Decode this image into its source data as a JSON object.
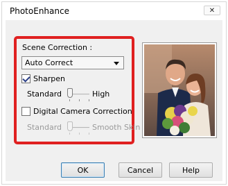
{
  "window": {
    "title": "PhotoEnhance",
    "close_glyph": "✕"
  },
  "scene": {
    "label": "Scene Correction :",
    "selected": "Auto Correct"
  },
  "sharpen": {
    "label": "Sharpen",
    "checked": true,
    "low_label": "Standard",
    "high_label": "High",
    "level": 0
  },
  "digital_camera": {
    "label": "Digital Camera Correction",
    "checked": false,
    "low_label": "Standard",
    "high_label": "Smooth Skin",
    "level": 0
  },
  "buttons": {
    "ok": "OK",
    "cancel": "Cancel",
    "help": "Help"
  },
  "colors": {
    "highlight": "#e02020",
    "checkmark": "#2a3e86",
    "client_bg": "#f0f0f0"
  },
  "icons": {
    "close": "close-icon",
    "dropdown": "chevron-down-icon",
    "check": "checkmark-icon"
  }
}
